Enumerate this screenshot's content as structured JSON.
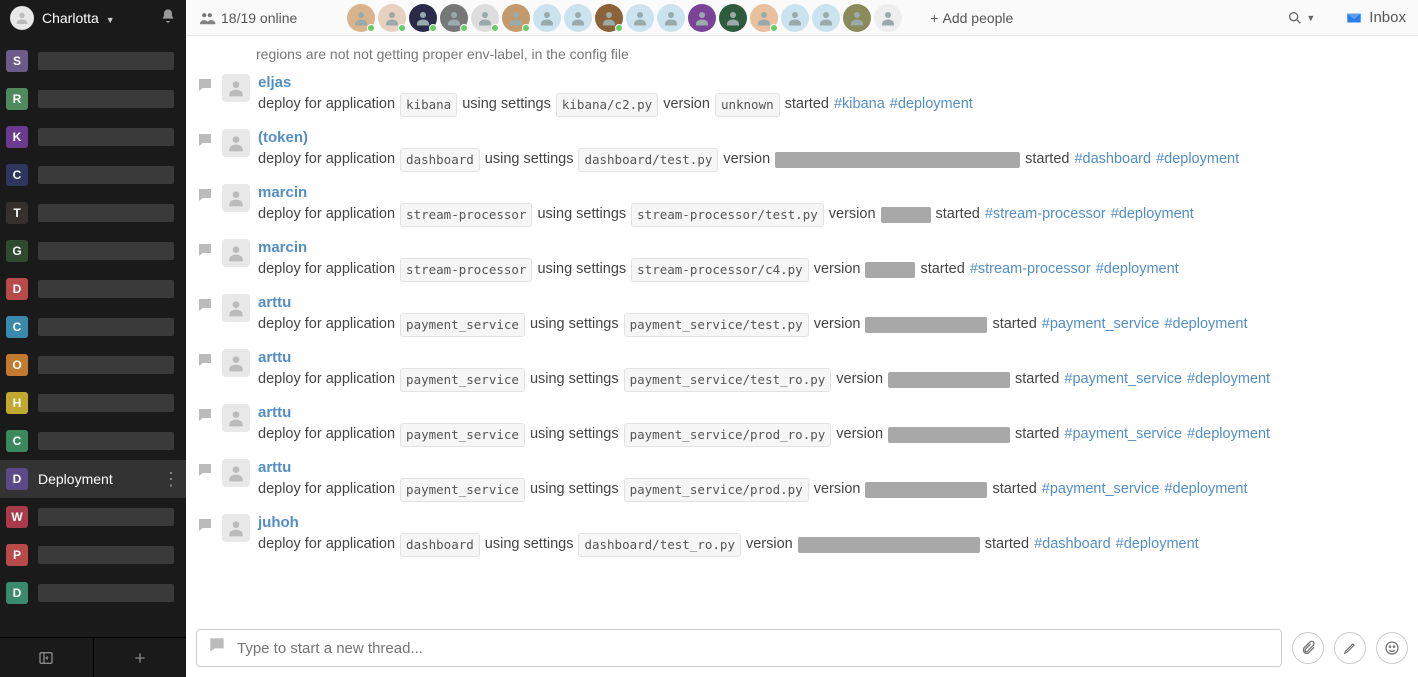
{
  "sidebar": {
    "username": "Charlotta",
    "channels": [
      {
        "letter": "S",
        "color": "#6b5b8a"
      },
      {
        "letter": "R",
        "color": "#4f8a5d"
      },
      {
        "letter": "K",
        "color": "#6a3a8f"
      },
      {
        "letter": "C",
        "color": "#2e3660"
      },
      {
        "letter": "T",
        "color": "#35302e"
      },
      {
        "letter": "G",
        "color": "#2e4a2f"
      },
      {
        "letter": "D",
        "color": "#b84a4a"
      },
      {
        "letter": "C",
        "color": "#3a8aae"
      },
      {
        "letter": "O",
        "color": "#c27a2e"
      },
      {
        "letter": "H",
        "color": "#c2a82e"
      },
      {
        "letter": "C",
        "color": "#3a8a5d"
      }
    ],
    "active": {
      "letter": "D",
      "color": "#5a4a8a",
      "label": "Deployment"
    },
    "channels_after": [
      {
        "letter": "W",
        "color": "#a83a4a"
      },
      {
        "letter": "P",
        "color": "#b84a4a"
      },
      {
        "letter": "D",
        "color": "#3a8a6d"
      }
    ]
  },
  "topbar": {
    "online": "18/19 online",
    "add_people": "Add people",
    "inbox": "Inbox",
    "avatar_count": 18
  },
  "cutoff": "regions are not not getting proper env-label, in the config file",
  "messages": [
    {
      "author": "eljas",
      "text_prefix": "deploy for application",
      "app": "kibana",
      "settings": "kibana/c2.py",
      "version": "unknown",
      "version_redact_w": 0,
      "started": "started",
      "tags": [
        "#kibana",
        "#deployment"
      ]
    },
    {
      "author": "(token)",
      "text_prefix": "deploy for application",
      "app": "dashboard",
      "settings": "dashboard/test.py",
      "version": "",
      "version_redact_w": 245,
      "started": "started",
      "tags": [
        "#dashboard",
        "#deployment"
      ]
    },
    {
      "author": "marcin",
      "text_prefix": "deploy for application",
      "app": "stream-processor",
      "settings": "stream-processor/test.py",
      "version": "",
      "version_redact_w": 50,
      "started": "started",
      "tags": [
        "#stream-processor",
        "#deployment"
      ]
    },
    {
      "author": "marcin",
      "text_prefix": "deploy for application",
      "app": "stream-processor",
      "settings": "stream-processor/c4.py",
      "version": "",
      "version_redact_w": 50,
      "started": "started",
      "tags": [
        "#stream-processor",
        "#deployment"
      ]
    },
    {
      "author": "arttu",
      "text_prefix": "deploy for application",
      "app": "payment_service",
      "settings": "payment_service/test.py",
      "version": "",
      "version_redact_w": 122,
      "started": "started",
      "tags": [
        "#payment_service",
        "#deployment"
      ]
    },
    {
      "author": "arttu",
      "text_prefix": "deploy for application",
      "app": "payment_service",
      "settings": "payment_service/test_ro.py",
      "version": "",
      "version_redact_w": 122,
      "started": "started",
      "tags": [
        "#payment_service",
        "#deployment"
      ]
    },
    {
      "author": "arttu",
      "text_prefix": "deploy for application",
      "app": "payment_service",
      "settings": "payment_service/prod_ro.py",
      "version": "",
      "version_redact_w": 122,
      "started": "started",
      "tags": [
        "#payment_service",
        "#deployment"
      ]
    },
    {
      "author": "arttu",
      "text_prefix": "deploy for application",
      "app": "payment_service",
      "settings": "payment_service/prod.py",
      "version": "",
      "version_redact_w": 122,
      "started": "started",
      "tags": [
        "#payment_service",
        "#deployment"
      ]
    },
    {
      "author": "juhoh",
      "text_prefix": "deploy for application",
      "app": "dashboard",
      "settings": "dashboard/test_ro.py",
      "version": "",
      "version_redact_w": 182,
      "started": "started",
      "tags": [
        "#dashboard",
        "#deployment"
      ]
    }
  ],
  "labels": {
    "using_settings": "using settings",
    "version": "version"
  },
  "compose": {
    "placeholder": "Type to start a new thread..."
  }
}
